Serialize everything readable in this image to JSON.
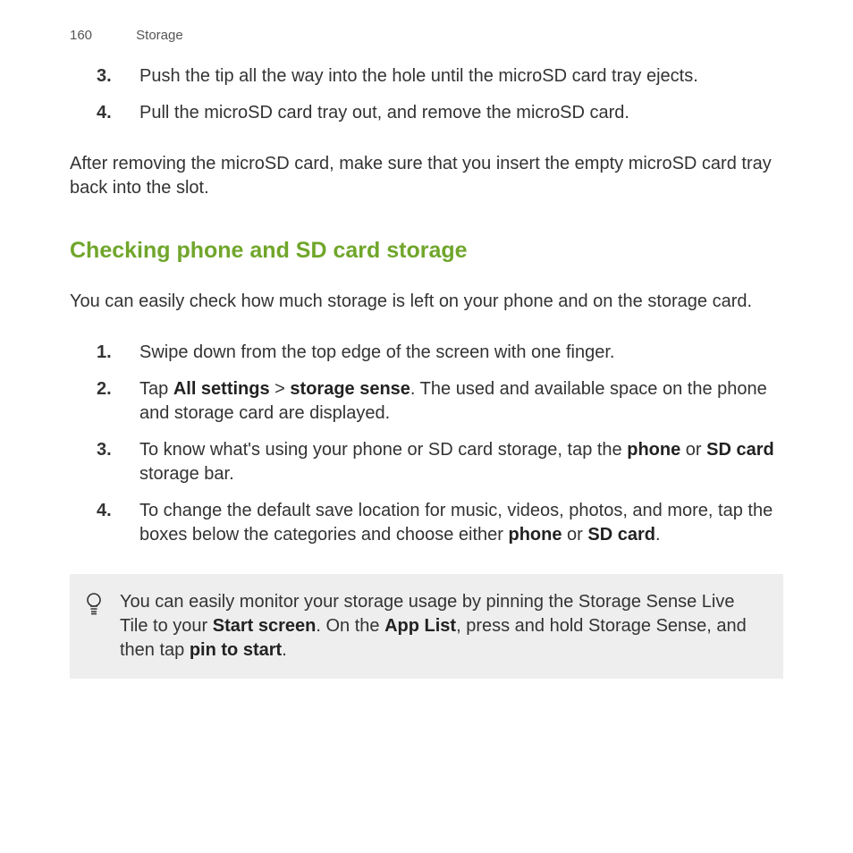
{
  "header": {
    "pageNumber": "160",
    "section": "Storage"
  },
  "topSteps": [
    {
      "n": "3.",
      "text": "Push the tip all the way into the hole until the microSD card tray ejects."
    },
    {
      "n": "4.",
      "text": "Pull the microSD card tray out, and remove the microSD card."
    }
  ],
  "afterRemoving": "After removing the microSD card, make sure that you insert the empty microSD card tray back into the slot.",
  "sectionTitle": "Checking phone and SD card storage",
  "intro": "You can easily check how much storage is left on your phone and on the storage card.",
  "steps": [
    {
      "n": "1.",
      "text": "Swipe down from the top edge of the screen with one finger."
    },
    {
      "n": "2.",
      "pre": "Tap ",
      "bold1": "All settings",
      "mid1": " > ",
      "bold2": "storage sense",
      "post": ". The used and available space on the phone and storage card are displayed."
    },
    {
      "n": "3.",
      "pre": "To know what's using your phone or SD card storage, tap the ",
      "bold1": "phone",
      "mid1": " or ",
      "bold2": "SD card",
      "post": " storage bar."
    },
    {
      "n": "4.",
      "pre": "To change the default save location for music, videos, photos, and more, tap the boxes below the categories and choose either ",
      "bold1": "phone",
      "mid1": " or ",
      "bold2": "SD card",
      "post": "."
    }
  ],
  "tip": {
    "pre": "You can easily monitor your storage usage by pinning the Storage Sense Live Tile to your ",
    "bold1": "Start screen",
    "mid1": ". On the ",
    "bold2": "App List",
    "mid2": ", press and hold Storage Sense, and then tap ",
    "bold3": "pin to start",
    "post": "."
  }
}
